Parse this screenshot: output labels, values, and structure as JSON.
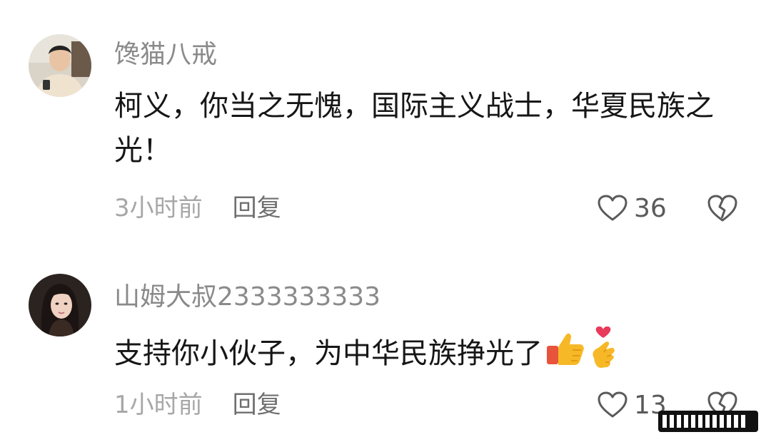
{
  "comments": [
    {
      "username": "馋猫八戒",
      "content": "柯义，你当之无愧，国际主义战士，华夏民族之光！",
      "time": "3小时前",
      "reply_label": "回复",
      "likes": "36",
      "avatar_icon": "user-avatar-man"
    },
    {
      "username": "山姆大叔2333333333",
      "content": "支持你小伙子，为中华民族挣光了",
      "emojis": [
        "thumbs-up-emoji",
        "finger-heart-emoji"
      ],
      "time": "1小时前",
      "reply_label": "回复",
      "likes": "13",
      "avatar_icon": "user-avatar-woman"
    }
  ],
  "colors": {
    "username": "#8a8a8a",
    "content": "#161616",
    "time": "#a7a7a7",
    "reply": "#6f6f6f"
  }
}
